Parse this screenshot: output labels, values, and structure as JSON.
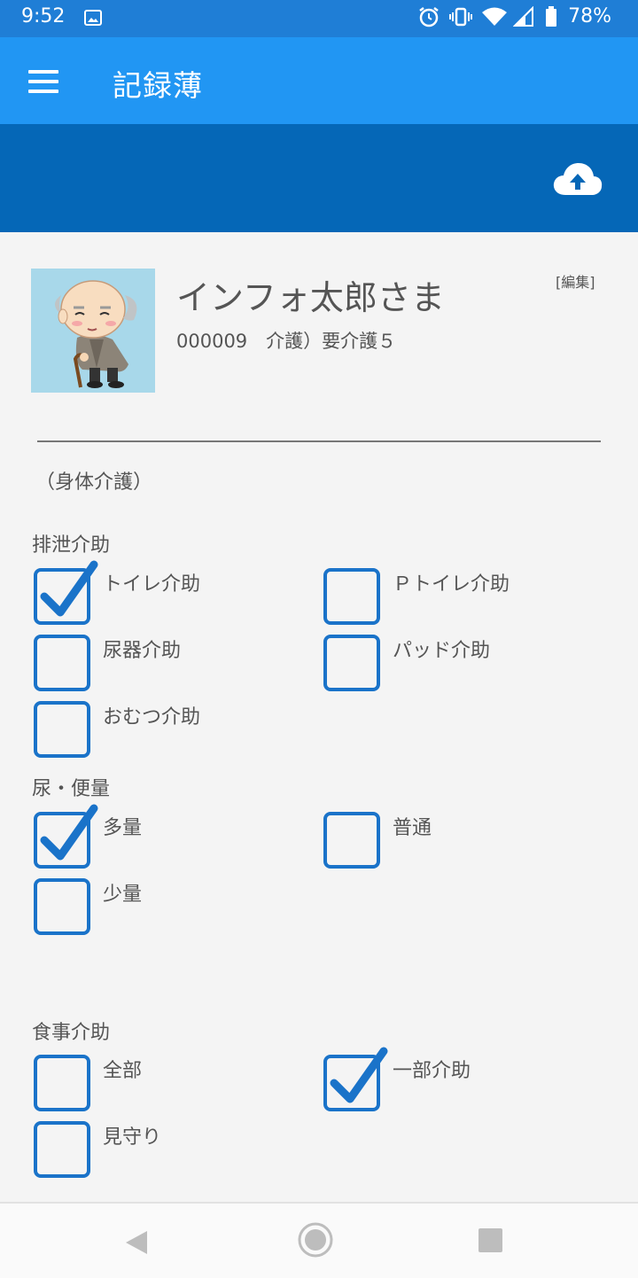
{
  "status_bar": {
    "time": "9:52",
    "battery": "78%",
    "icons": [
      "image-icon",
      "alarm-icon",
      "vibrate-icon",
      "wifi-icon",
      "signal-icon",
      "battery-icon"
    ]
  },
  "app_bar": {
    "title": "記録薄",
    "menu_icon": "menu-icon"
  },
  "action_bar": {
    "upload_icon": "cloud-upload-icon"
  },
  "profile": {
    "name": "インフォ太郎さま",
    "id_care": "000009　介護）要介護５",
    "edit_label": "[編集]"
  },
  "category_label": "（身体介護）",
  "sections": [
    {
      "title": "排泄介助",
      "options": [
        {
          "label": "トイレ介助",
          "checked": true
        },
        {
          "label": "Ｐトイレ介助",
          "checked": false
        },
        {
          "label": "尿器介助",
          "checked": false
        },
        {
          "label": "パッド介助",
          "checked": false
        },
        {
          "label": "おむつ介助",
          "checked": false
        }
      ]
    },
    {
      "title": "尿・便量",
      "options": [
        {
          "label": "多量",
          "checked": true
        },
        {
          "label": "普通",
          "checked": false
        },
        {
          "label": "少量",
          "checked": false
        }
      ]
    },
    {
      "title": "食事介助",
      "options": [
        {
          "label": "全部",
          "checked": false
        },
        {
          "label": "一部介助",
          "checked": true
        },
        {
          "label": "見守り",
          "checked": false
        }
      ]
    }
  ],
  "colors": {
    "status_bar": "#1f7ed6",
    "app_bar": "#2196f3",
    "action_bar": "#0567b7",
    "checkbox": "#1a73c9",
    "background": "#f4f4f4"
  }
}
